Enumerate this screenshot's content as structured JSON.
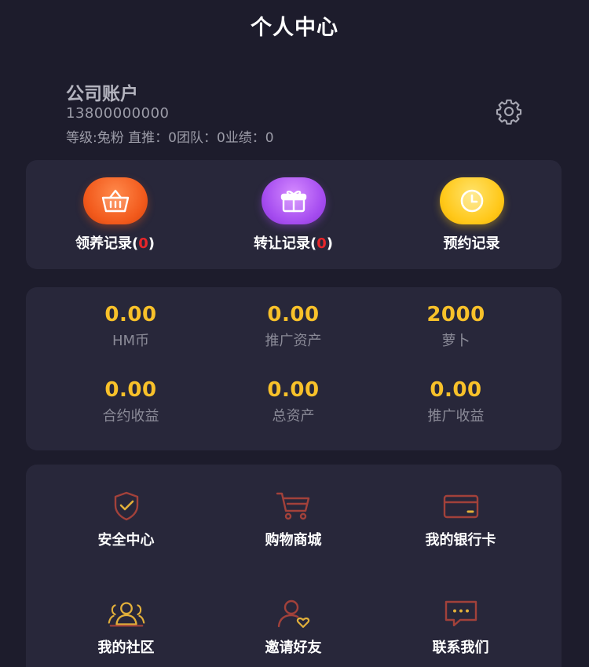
{
  "header": {
    "title": "个人中心"
  },
  "profile": {
    "name": "公司账户",
    "phone": "13800000000",
    "stats": "等级:兔粉 直推：0团队：0业绩：0",
    "settings_icon": "gear-icon"
  },
  "records": [
    {
      "label": "领养记录(",
      "count": "0",
      "suffix": ")",
      "icon": "basket-icon",
      "color": "#f25a1c"
    },
    {
      "label": "转让记录(",
      "count": "0",
      "suffix": ")",
      "icon": "gift-icon",
      "color": "#a64df0"
    },
    {
      "label": "预约记录",
      "count": "",
      "suffix": "",
      "icon": "clock-icon",
      "color": "#ffc81a"
    }
  ],
  "balances": [
    {
      "value": "0.00",
      "label": "HM币"
    },
    {
      "value": "0.00",
      "label": "推广资产"
    },
    {
      "value": "2000",
      "label": "萝卜"
    },
    {
      "value": "0.00",
      "label": "合约收益"
    },
    {
      "value": "0.00",
      "label": "总资产"
    },
    {
      "value": "0.00",
      "label": "推广收益"
    }
  ],
  "menu": [
    {
      "label": "安全中心",
      "icon": "shield-check-icon"
    },
    {
      "label": "购物商城",
      "icon": "shopping-cart-icon"
    },
    {
      "label": "我的银行卡",
      "icon": "bank-card-icon"
    },
    {
      "label": "我的社区",
      "icon": "community-icon"
    },
    {
      "label": "邀请好友",
      "icon": "invite-friend-icon"
    },
    {
      "label": "联系我们",
      "icon": "chat-bubble-icon"
    }
  ],
  "colors": {
    "accent_gold": "#f8c12a",
    "icon_brown": "#a2413a",
    "icon_gold": "#e2b03a",
    "alert_red": "#e8262a"
  }
}
